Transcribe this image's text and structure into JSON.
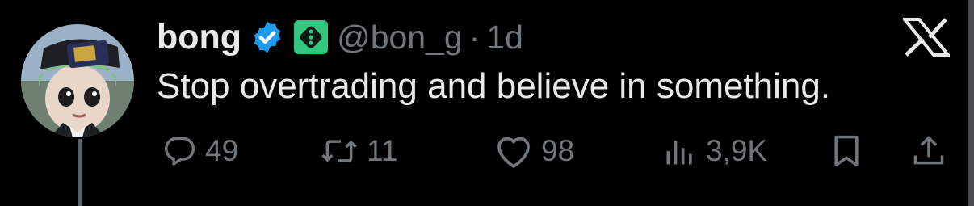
{
  "tweet": {
    "author_name": "bong",
    "handle": "@bon_g",
    "separator": "·",
    "time": "1d",
    "text": "Stop overtrading and believe in something."
  },
  "icons": {
    "verified": "verified-badge-icon",
    "affiliation": "affiliation-badge-icon",
    "brand": "x-logo-icon",
    "reply": "reply-icon",
    "retweet": "retweet-icon",
    "like": "heart-icon",
    "views": "views-icon",
    "bookmark": "bookmark-icon",
    "share": "share-icon"
  },
  "metrics": {
    "replies": "49",
    "retweets": "11",
    "likes": "98",
    "views": "3,9K"
  },
  "colors": {
    "background": "#000000",
    "text": "#e7e9ea",
    "muted": "#71767b",
    "verified_blue": "#1d9bf0",
    "affiliation_green": "#33c67f"
  }
}
